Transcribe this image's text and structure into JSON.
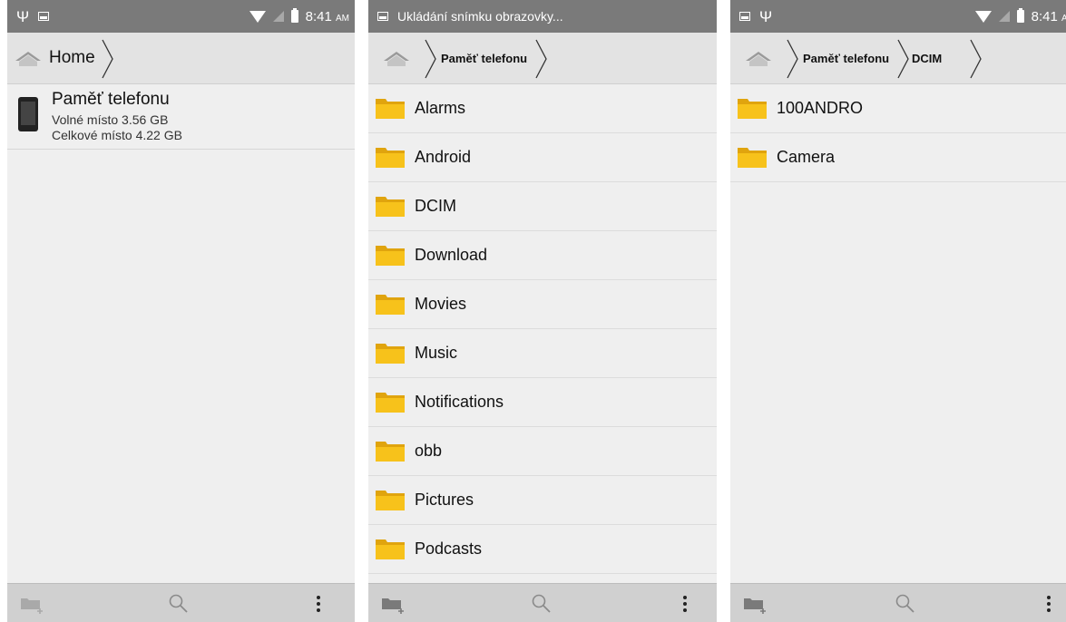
{
  "status": {
    "time": "8:41",
    "ampm": "AM",
    "notification": "Ukládání snímku obrazovky..."
  },
  "screen1": {
    "breadcrumb": [
      "Home"
    ],
    "storage": {
      "name": "Paměť telefonu",
      "free": "Volné místo 3.56 GB",
      "total": "Celkové místo 4.22 GB"
    }
  },
  "screen2": {
    "breadcrumb": [
      "Paměť telefonu"
    ],
    "folders": [
      "Alarms",
      "Android",
      "DCIM",
      "Download",
      "Movies",
      "Music",
      "Notifications",
      "obb",
      "Pictures",
      "Podcasts"
    ]
  },
  "screen3": {
    "breadcrumb": [
      "Paměť telefonu",
      "DCIM"
    ],
    "folders": [
      "100ANDRO",
      "Camera"
    ]
  },
  "icons": {
    "home": "home-icon",
    "folder": "folder-icon",
    "new_folder": "new-folder-icon",
    "search": "search-icon",
    "menu": "overflow-menu-icon"
  },
  "colors": {
    "status_bar": "#7a7a7a",
    "breadcrumb_bar": "#e3e3e3",
    "folder": "#f7c21b",
    "bottom_bar": "#d0d0d0"
  }
}
